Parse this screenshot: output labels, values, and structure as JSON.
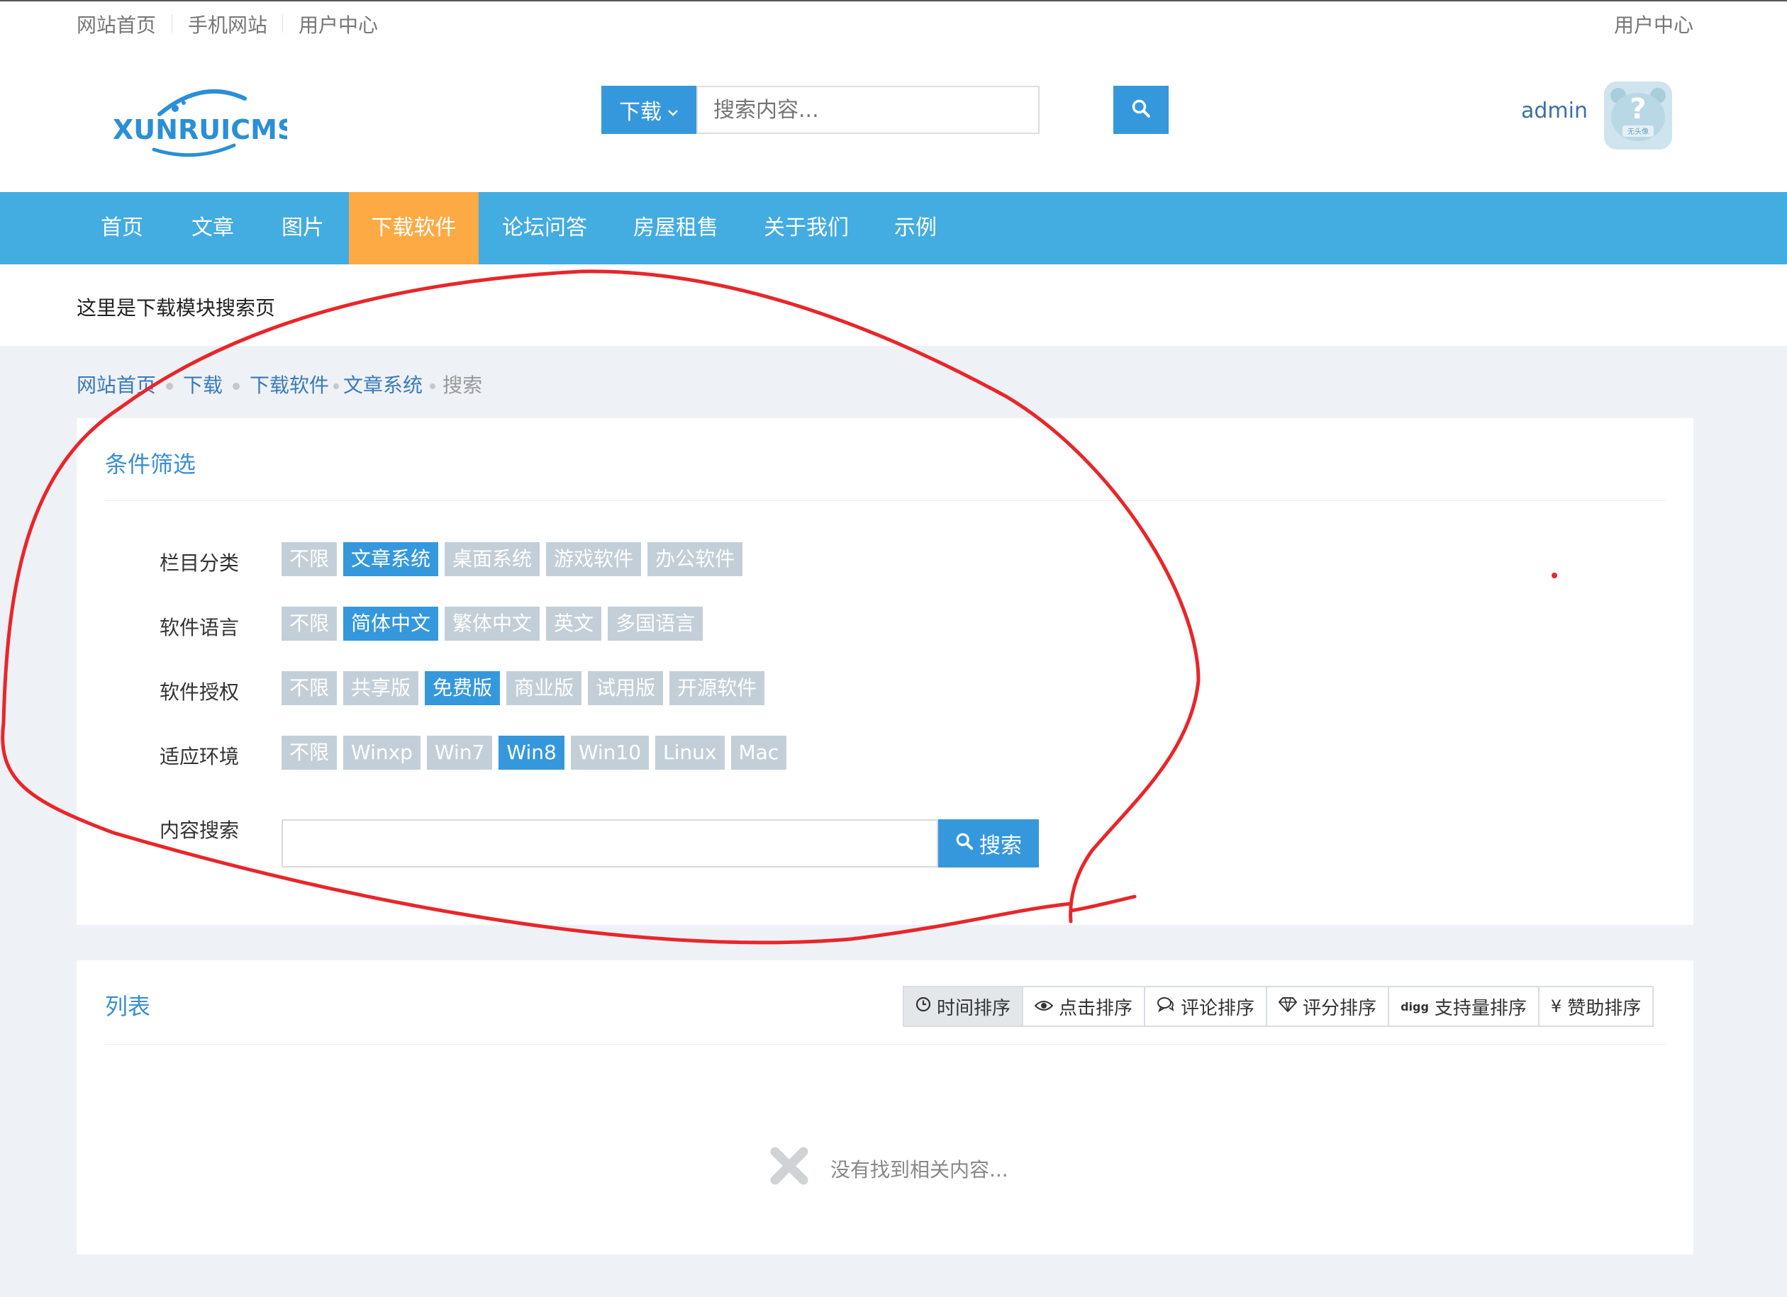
{
  "topbar": {
    "links": [
      "网站首页",
      "手机网站",
      "用户中心"
    ],
    "right_link": "用户中心"
  },
  "header": {
    "logo_text": "XUNRUICMS",
    "search": {
      "type_label": "下载",
      "placeholder": "搜索内容..."
    },
    "username": "admin",
    "avatar_text": "?",
    "avatar_caption": "无头像"
  },
  "nav": {
    "items": [
      "首页",
      "文章",
      "图片",
      "下载软件",
      "论坛问答",
      "房屋租售",
      "关于我们",
      "示例"
    ],
    "active": "下载软件"
  },
  "notice": "这里是下载模块搜索页",
  "breadcrumb": [
    "网站首页",
    "下载",
    "下载软件",
    "文章系统",
    "搜索"
  ],
  "filter": {
    "title": "条件筛选",
    "rows": [
      {
        "label": "栏目分类",
        "options": [
          "不限",
          "文章系统",
          "桌面系统",
          "游戏软件",
          "办公软件"
        ],
        "selected": "文章系统"
      },
      {
        "label": "软件语言",
        "options": [
          "不限",
          "简体中文",
          "繁体中文",
          "英文",
          "多国语言"
        ],
        "selected": "简体中文"
      },
      {
        "label": "软件授权",
        "options": [
          "不限",
          "共享版",
          "免费版",
          "商业版",
          "试用版",
          "开源软件"
        ],
        "selected": "免费版"
      },
      {
        "label": "适应环境",
        "options": [
          "不限",
          "Winxp",
          "Win7",
          "Win8",
          "Win10",
          "Linux",
          "Mac"
        ],
        "selected": "Win8"
      }
    ],
    "keyword_label": "内容搜索",
    "keyword_value": "",
    "search_button": "搜索"
  },
  "list": {
    "title": "列表",
    "sort_buttons": [
      {
        "icon": "clock-icon",
        "label": "时间排序",
        "active": true
      },
      {
        "icon": "eye-icon",
        "label": "点击排序",
        "active": false
      },
      {
        "icon": "comment-icon",
        "label": "评论排序",
        "active": false
      },
      {
        "icon": "diamond-icon",
        "label": "评分排序",
        "active": false
      },
      {
        "icon": "digg-icon",
        "icon_text": "digg",
        "label": "支持量排序",
        "active": false
      },
      {
        "icon": "yen-icon",
        "icon_text": "¥",
        "label": "赞助排序",
        "active": false
      }
    ],
    "empty_text": "没有找到相关内容..."
  },
  "colors": {
    "primary": "#3598dc",
    "nav_bg": "#43ace1",
    "nav_active": "#fdaa45",
    "tag_bg": "#c3cfd8",
    "page_bg": "#eef1f5",
    "annotation": "#e8262a"
  }
}
